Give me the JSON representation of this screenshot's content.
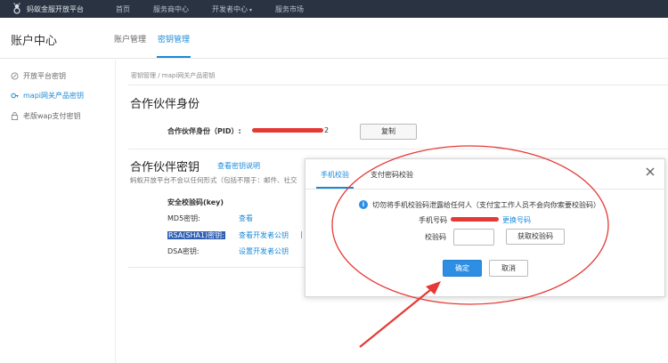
{
  "topnav": {
    "brand": "蚂蚁金服开放平台",
    "items": [
      "首页",
      "服务商中心",
      "开发者中心",
      "服务市场"
    ],
    "caret": "▾"
  },
  "subheader": {
    "title": "账户中心",
    "tabs": [
      {
        "label": "账户管理",
        "active": false
      },
      {
        "label": "密钥管理",
        "active": true
      }
    ]
  },
  "sidebar": {
    "items": [
      {
        "label": "开放平台密钥",
        "icon": "link-icon",
        "active": false
      },
      {
        "label": "mapi网关产品密钥",
        "icon": "key-icon",
        "active": true
      },
      {
        "label": "老版wap支付密钥",
        "icon": "lock-icon",
        "active": false
      }
    ]
  },
  "main": {
    "breadcrumb": "密钥管理 / mapi网关产品密钥",
    "partner_identity": {
      "title": "合作伙伴身份",
      "pid_label": "合作伙伴身份（PID）:",
      "pid_suffix": "2",
      "copy_button": "复制"
    },
    "partner_key": {
      "title": "合作伙伴密钥",
      "help_link": "查看密钥说明",
      "notice": "蚂蚁开放平台不会以任何形式（包括不限于：邮件、社交",
      "security_label": "安全校验码(key)",
      "rows": [
        {
          "label": "MD5密钥:",
          "action": "查看",
          "highlighted": false
        },
        {
          "label": "RSA(SHA1)密钥:",
          "action": "查看开发者公钥",
          "highlighted": true,
          "divider": "|"
        },
        {
          "label": "DSA密钥:",
          "action": "设置开发者公钥",
          "highlighted": false
        }
      ]
    }
  },
  "modal": {
    "tabs": [
      {
        "label": "手机校验",
        "active": true
      },
      {
        "label": "支付密码校验",
        "active": false
      }
    ],
    "info_glyph": "i",
    "notice": "切勿将手机校验码泄露给任何人（支付宝工作人员不会向你索要校验码）",
    "phone_label": "手机号码",
    "change_phone_link": "更换号码",
    "code_label": "校验码",
    "code_value": "",
    "get_code_button": "获取校验码",
    "confirm_button": "确定",
    "cancel_button": "取消"
  },
  "colors": {
    "accent": "#1a8ad8",
    "topbar": "#2a3342",
    "annotation": "#e53935"
  }
}
